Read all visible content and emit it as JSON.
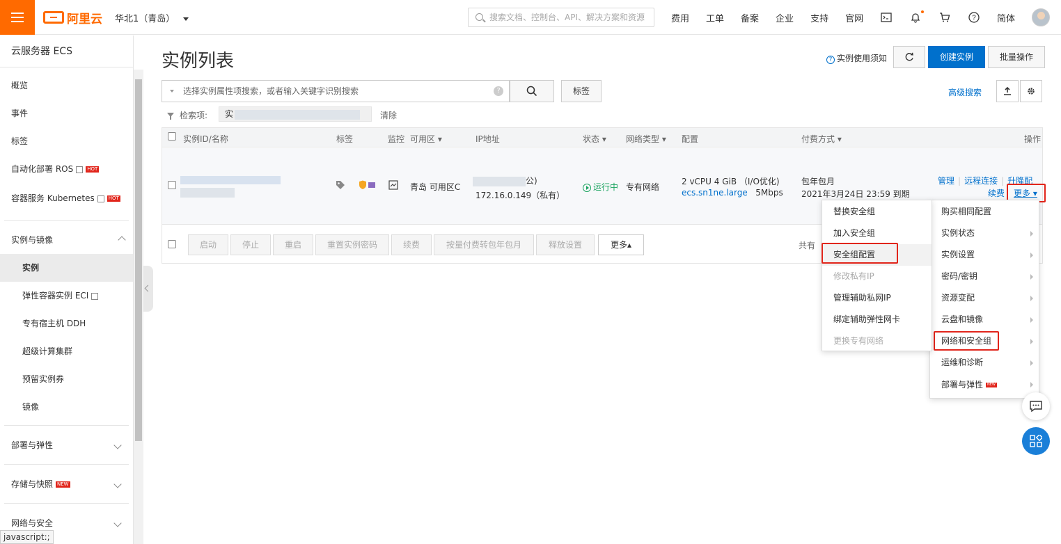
{
  "topbar": {
    "brand": "阿里云",
    "region": "华北1（青岛）",
    "search_placeholder": "搜索文档、控制台、API、解决方案和资源",
    "nav": [
      "费用",
      "工单",
      "备案",
      "企业",
      "支持",
      "官网"
    ],
    "lang": "简体",
    "accent": "#ff6a00"
  },
  "sidebar": {
    "title": "云服务器 ECS",
    "top_items": [
      {
        "label": "概览"
      },
      {
        "label": "事件"
      },
      {
        "label": "标签"
      },
      {
        "label": "自动化部署 ROS",
        "badge": "HOT"
      },
      {
        "label": "容器服务 Kubernetes",
        "badge": "HOT"
      }
    ],
    "section_instances": "实例与镜像",
    "sub_items": [
      {
        "label": "实例",
        "active": true
      },
      {
        "label": "弹性容器实例 ECI"
      },
      {
        "label": "专有宿主机 DDH"
      },
      {
        "label": "超级计算集群"
      },
      {
        "label": "预留实例券"
      },
      {
        "label": "镜像"
      }
    ],
    "groups": [
      {
        "label": "部署与弹性"
      },
      {
        "label": "存储与快照",
        "badge": "NEW"
      },
      {
        "label": "网络与安全"
      }
    ]
  },
  "main": {
    "title": "实例列表",
    "help": "实例使用须知",
    "create_button": "创建实例",
    "batch_button": "批量操作",
    "filter_placeholder": "选择实例属性项搜索，或者输入关键字识别搜索",
    "tag_button": "标签",
    "advanced_search": "高级搜索",
    "criteria_label": "检索项:",
    "criteria_value": "实",
    "clear": "清除",
    "columns": [
      "实例ID/名称",
      "标签",
      "监控",
      "可用区",
      "IP地址",
      "状态",
      "网络类型",
      "配置",
      "付费方式",
      "操作"
    ],
    "row": {
      "zone": "青岛 可用区C",
      "ip_public_suffix": "公)",
      "ip_private": "172.16.0.149（私有）",
      "status": "运行中",
      "network": "专有网络",
      "config_line1": "2 vCPU 4 GiB （I/O优化)",
      "instance_type": "ecs.sn1ne.large",
      "bandwidth": "5Mbps",
      "billing": "包年包月",
      "expiry": "2021年3月24日 23:59 到期",
      "actions": [
        "管理",
        "远程连接",
        "升降配"
      ],
      "renew": "续费",
      "more": "更多"
    },
    "footer_buttons": [
      "启动",
      "停止",
      "重启",
      "重置实例密码",
      "续费",
      "按量付费转包年包月",
      "释放设置"
    ],
    "footer_more": "更多",
    "footer_total": "共有"
  },
  "more_menu": [
    {
      "label": "购买相同配置",
      "submenu": false
    },
    {
      "label": "实例状态",
      "submenu": true
    },
    {
      "label": "实例设置",
      "submenu": true
    },
    {
      "label": "密码/密钥",
      "submenu": true
    },
    {
      "label": "资源变配",
      "submenu": true
    },
    {
      "label": "云盘和镜像",
      "submenu": true
    },
    {
      "label": "网络和安全组",
      "submenu": true,
      "highlighted": true
    },
    {
      "label": "运维和诊断",
      "submenu": true
    },
    {
      "label": "部署与弹性",
      "submenu": true,
      "badge": "NEW"
    }
  ],
  "network_submenu": [
    {
      "label": "替换安全组",
      "disabled": false
    },
    {
      "label": "加入安全组",
      "disabled": false
    },
    {
      "label": "安全组配置",
      "disabled": false,
      "highlighted": true
    },
    {
      "label": "修改私有IP",
      "disabled": true
    },
    {
      "label": "管理辅助私网IP",
      "disabled": false
    },
    {
      "label": "绑定辅助弹性网卡",
      "disabled": false
    },
    {
      "label": "更换专有网络",
      "disabled": true
    }
  ],
  "status_bar": "javascript:;",
  "colors": {
    "primary": "#0070cc",
    "highlight": "#e1251b",
    "running": "#1aa35f"
  }
}
